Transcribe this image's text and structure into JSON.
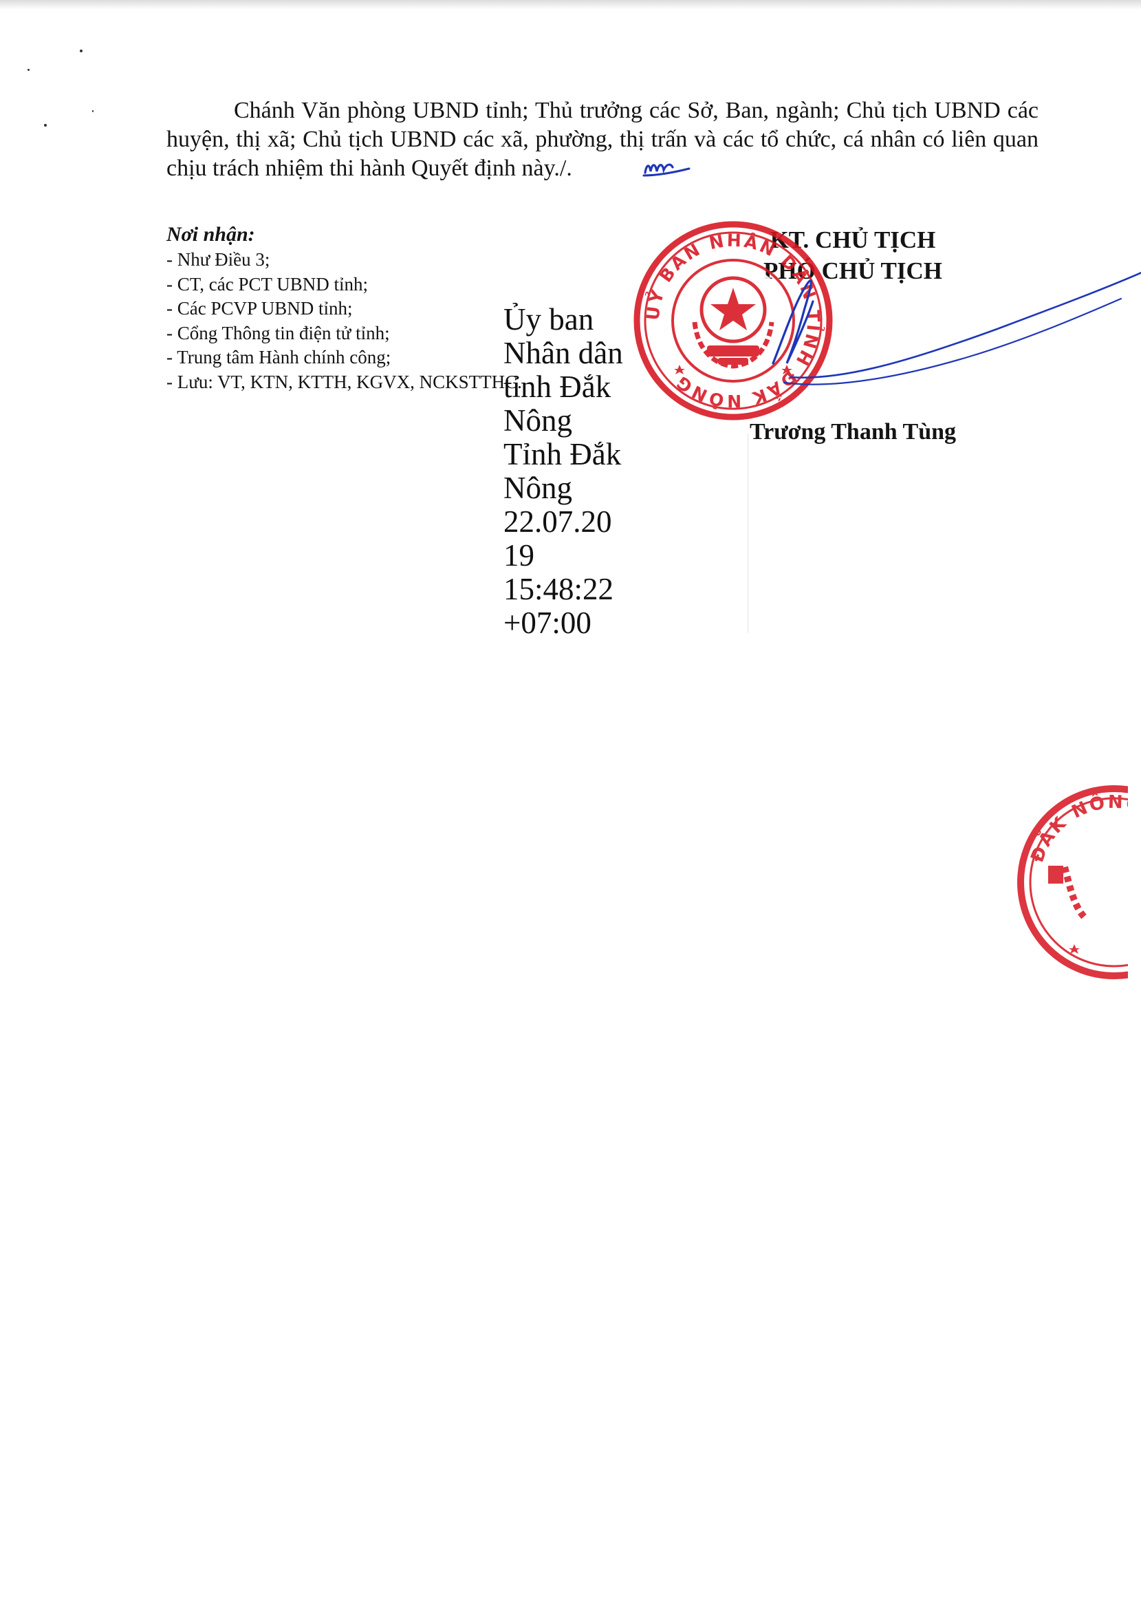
{
  "body_paragraph": "Chánh Văn phòng UBND tỉnh; Thủ trưởng các Sở, Ban, ngành; Chủ tịch UBND các huyện, thị xã; Chủ tịch UBND các xã, phường, thị trấn và các tổ chức, cá nhân có liên quan chịu trách nhiệm thi hành Quyết định này./.",
  "recipients": {
    "heading": "Nơi nhận:",
    "items": [
      "- Như Điều 3;",
      "- CT, các PCT UBND tỉnh;",
      "- Các PCVP UBND tỉnh;",
      "- Cổng Thông tin điện tử tỉnh;",
      "- Trung tâm Hành chính công;",
      "- Lưu: VT, KTN, KTTH, KGVX, NCKSTTHC."
    ]
  },
  "signer": {
    "line1": "KT. CHỦ TỊCH",
    "line2": "PHÓ CHỦ TỊCH",
    "name": "Trương Thanh Tùng"
  },
  "digital_signature": {
    "lines": [
      "Ủy ban",
      "Nhân dân",
      "tỉnh Đắk",
      "Nông",
      "Tỉnh Đắk",
      "Nông",
      "22.07.20",
      "19",
      "15:48:22",
      "+07:00"
    ]
  },
  "seal": {
    "text": "UỶ BAN NHÂN DÂN TỈNH ĐẮK NÔNG",
    "partial_text": "ĐẮK NÔNG",
    "color": "#d7141f"
  },
  "ink_color": "#1f36b8"
}
